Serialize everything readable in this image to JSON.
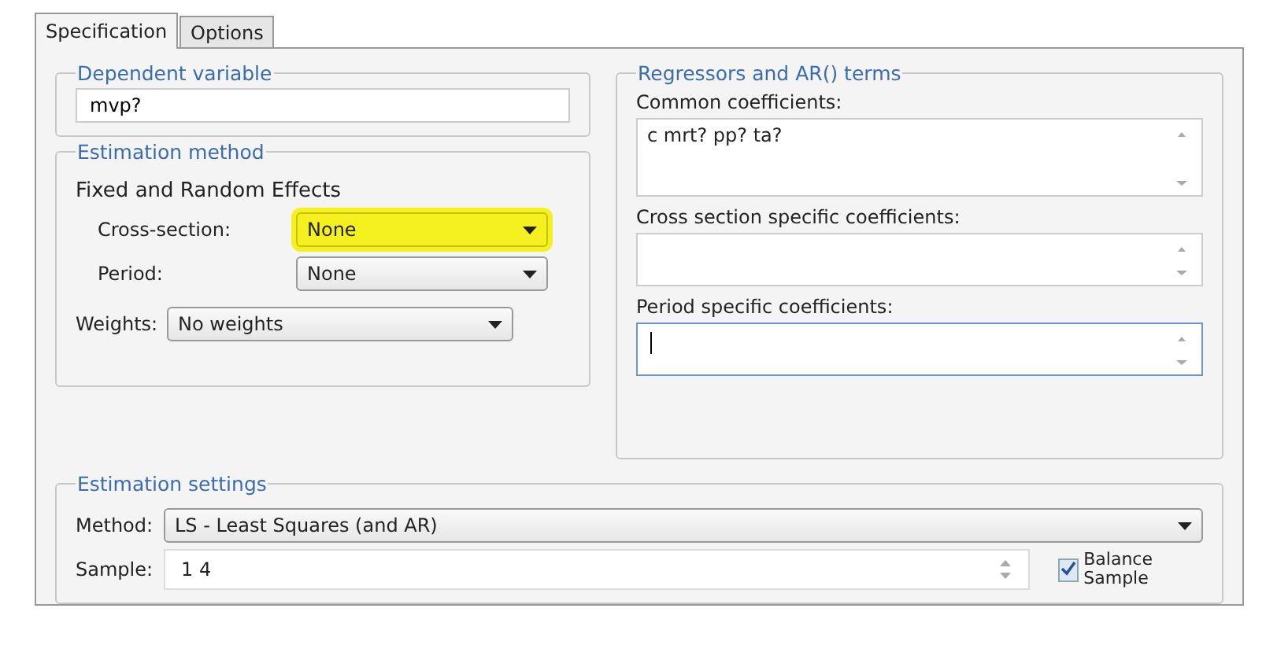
{
  "tabs": [
    {
      "label": "Specification",
      "selected": true
    },
    {
      "label": "Options",
      "selected": false
    }
  ],
  "dependent_variable": {
    "title": "Dependent variable",
    "value": "mvp?"
  },
  "estimation_method": {
    "title": "Estimation method",
    "subtitle": "Fixed and Random Effects",
    "dropdowns": [
      {
        "label": "Cross-section:",
        "value": "None",
        "highlighted": true
      },
      {
        "label": "Period:",
        "value": "None",
        "highlighted": false
      }
    ],
    "weights": {
      "label": "Weights:",
      "value": "No weights"
    }
  },
  "regressors": {
    "title": "Regressors and AR() terms",
    "fields": [
      {
        "label": "Common coefficients:",
        "value": "c mrt? pp? ta?",
        "focused": false
      },
      {
        "label": "Cross section specific coefficients:",
        "focused": false
      },
      {
        "label": "Period specific coefficients:",
        "focused": true
      }
    ]
  },
  "estimation_settings": {
    "title": "Estimation settings",
    "method": {
      "label": "Method:",
      "value": "LS - Least Squares (and AR)"
    },
    "sample": {
      "label": "Sample:",
      "value": "1 4"
    },
    "balance": {
      "label": "Balance Sample",
      "checked": true
    }
  }
}
